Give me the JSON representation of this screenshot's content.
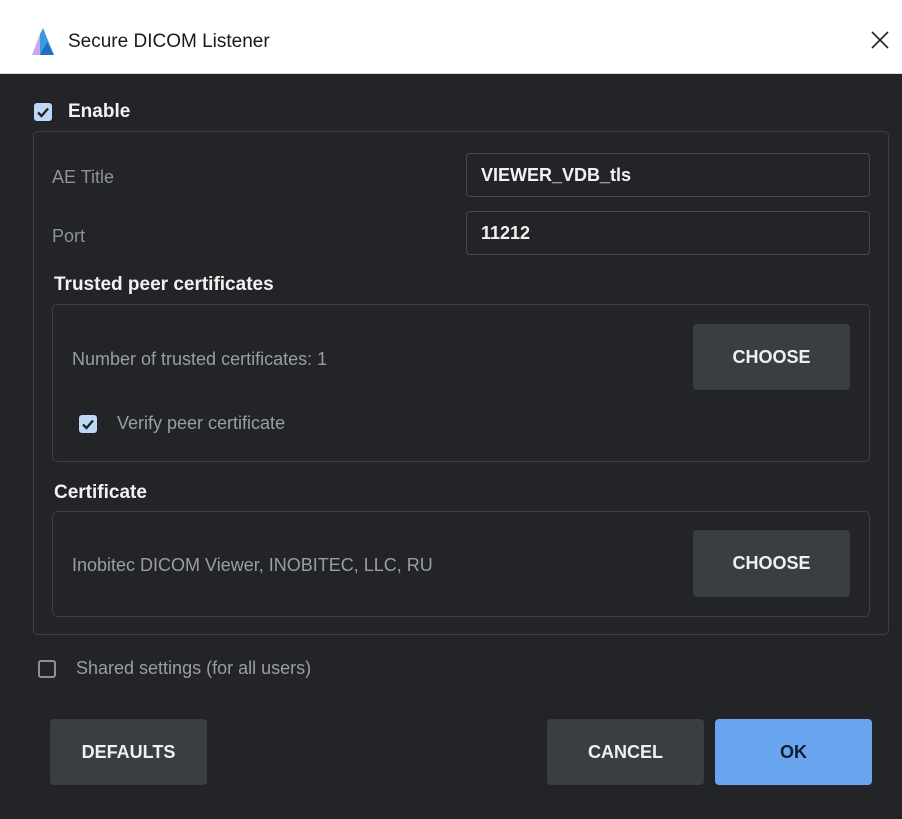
{
  "window": {
    "title": "Secure DICOM Listener"
  },
  "enable": {
    "label": "Enable",
    "checked": true
  },
  "ae_title": {
    "label": "AE Title",
    "value": "VIEWER_VDB_tls"
  },
  "port": {
    "label": "Port",
    "value": "11212"
  },
  "trusted": {
    "heading": "Trusted peer certificates",
    "count_text": "Number of trusted certificates: 1",
    "choose_label": "CHOOSE",
    "verify_label": "Verify peer certificate",
    "verify_checked": true
  },
  "certificate": {
    "heading": "Certificate",
    "value": "Inobitec DICOM Viewer, INOBITEC, LLC, RU",
    "choose_label": "CHOOSE"
  },
  "shared": {
    "label": "Shared settings (for all users)",
    "checked": false
  },
  "buttons": {
    "defaults": "DEFAULTS",
    "cancel": "CANCEL",
    "ok": "OK"
  },
  "colors": {
    "background": "#222427",
    "accent": "#6aa5f0",
    "checkbox": "#bfd7f7"
  }
}
